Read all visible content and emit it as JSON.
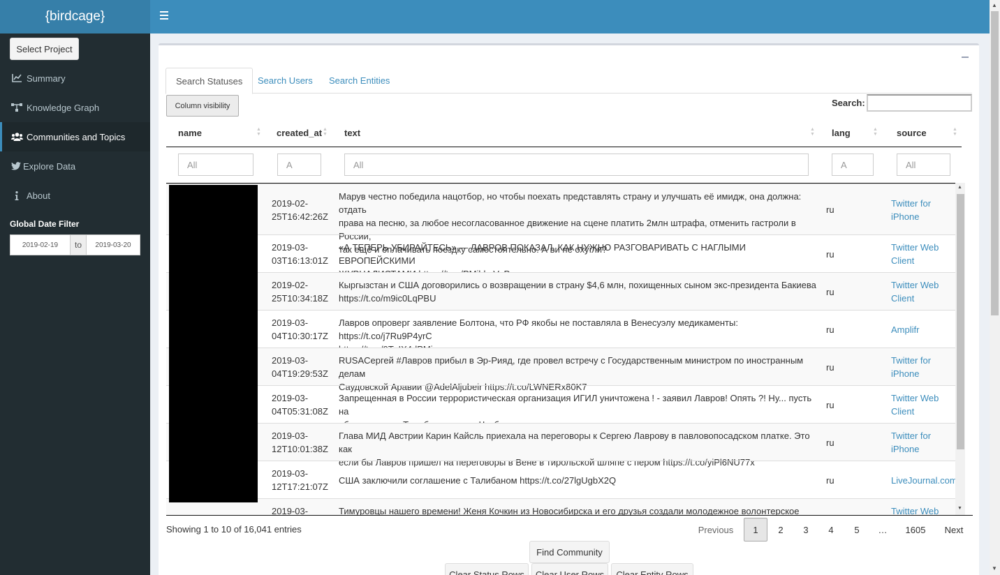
{
  "app": {
    "logo": "{birdcage}"
  },
  "sidebar": {
    "select_project": "Select Project",
    "items": [
      {
        "label": "Summary",
        "icon": "line-chart-icon"
      },
      {
        "label": "Knowledge Graph",
        "icon": "sitemap-icon"
      },
      {
        "label": "Communities and Topics",
        "icon": "users-icon",
        "active": true
      },
      {
        "label": "Explore Data",
        "icon": "twitter-icon"
      },
      {
        "label": "About",
        "icon": "info-icon"
      }
    ],
    "date_filter": {
      "title": "Global Date Filter",
      "from": "2019-02-19",
      "separator": "to",
      "to": "2019-03-20"
    }
  },
  "tabs": [
    {
      "label": "Search Statuses",
      "active": true
    },
    {
      "label": "Search Users"
    },
    {
      "label": "Search Entities"
    }
  ],
  "table_controls": {
    "column_visibility": "Column visibility",
    "search_label": "Search:",
    "search_value": ""
  },
  "columns": [
    "name",
    "created_at",
    "text",
    "lang",
    "source"
  ],
  "filters": {
    "name": "All",
    "created_at": "A",
    "text": "All",
    "lang": "A",
    "source": "All"
  },
  "rows": [
    {
      "created_at": [
        "2019-02-",
        "25T16:42:26Z"
      ],
      "text": [
        "Марув честно победила нацотбор, но чтобы поехать представлять страну и улучшать её имидж, она должна: отдать",
        "права на песню, за любое несогласованное движение на сцене платить 2млн штрафа, отменить гастроли в России,",
        "так ещё и оплачивать поездку самостоятельно. А ви не охуїли?"
      ],
      "lang": "ru",
      "source": [
        "Twitter for",
        "iPhone"
      ]
    },
    {
      "created_at": [
        "2019-03-",
        "03T16:13:01Z"
      ],
      "text": [
        "«А ТЕПЕРЬ УБИРАЙТЕСЬ» — ЛАВРОВ ПОКАЗАЛ, КАК НУЖНО РАЗГОВАРИВАТЬ С НАГЛЫМИ ЕВРОПЕЙСКИМИ",
        "ЖУРНАЛИСТАМИ https://t.co/PMjbhzVoPr"
      ],
      "lang": "ru",
      "source": [
        "Twitter Web",
        "Client"
      ]
    },
    {
      "created_at": [
        "2019-02-",
        "25T10:34:18Z"
      ],
      "text": [
        "Кыргызстан и США договорились о возвращении в страну $4,6 млн, похищенных сыном экс-президента Бакиева",
        "https://t.co/m9ic0LqPBU"
      ],
      "lang": "ru",
      "source": [
        "Twitter Web",
        "Client"
      ]
    },
    {
      "created_at": [
        "2019-03-",
        "04T10:30:17Z"
      ],
      "text": [
        "Лавров опроверг заявление Болтона, что РФ якобы не поставляла в Венесуэлу медикаменты: https://t.co/j7Ru9P4yrC",
        "https://t.co/9TuIX4dPMi"
      ],
      "lang": "ru",
      "source": [
        "Amplifr"
      ]
    },
    {
      "created_at": [
        "2019-03-",
        "04T19:29:53Z"
      ],
      "text": [
        "RUSAСергей #Лавров прибыл в Эр-Рияд, где провел встречу с Государственным министром по иностранным делам",
        "Саудовской Аравии @AdelAljubeir https://t.co/LWNERx80K7"
      ],
      "lang": "ru",
      "source": [
        "Twitter for",
        "iPhone"
      ]
    },
    {
      "created_at": [
        "2019-03-",
        "04T05:31:08Z"
      ],
      "text": [
        "Запрещенная в России террористическая организация ИГИЛ уничтожена ! - заявил Лавров! Опять ?! Ну... пусть на",
        "обратном пути Талибан возьмут. Чтоб два раза не ездить ."
      ],
      "lang": "ru",
      "source": [
        "Twitter Web",
        "Client"
      ]
    },
    {
      "created_at": [
        "2019-03-",
        "12T10:01:38Z"
      ],
      "text": [
        "Глава МИД Австрии Карин Кайсль приехала на переговоры к Сергею Лаврову в павловопосадском платке. Это как",
        "если бы Лавров пришел на переговоры в Вене в тирольской шляпе с пером https://t.co/yiPl6NU77x"
      ],
      "lang": "ru",
      "source": [
        "Twitter for",
        "iPhone"
      ]
    },
    {
      "created_at": [
        "2019-03-",
        "12T17:21:07Z"
      ],
      "text": [
        "США заключили соглашение с Талибаном https://t.co/27lgUgbX2Q"
      ],
      "lang": "ru",
      "source": [
        "LiveJournal.com"
      ]
    },
    {
      "created_at": [
        "2019-03-",
        ""
      ],
      "text": [
        "Тимуровцы нашего времени! Женя Кочкин из Новосибирска и его друзья создали молодежное волонтерское",
        ""
      ],
      "lang": "",
      "source": [
        "Twitter Web",
        ""
      ]
    }
  ],
  "footer": {
    "info": "Showing 1 to 10 of 16,041 entries",
    "pagination": {
      "previous": "Previous",
      "pages": [
        "1",
        "2",
        "3",
        "4",
        "5",
        "…",
        "1605"
      ],
      "next": "Next"
    }
  },
  "actions": {
    "find_community": "Find Community",
    "clear_status": "Clear Status Rows",
    "clear_user": "Clear User Rows",
    "clear_entity": "Clear Entity Rows"
  }
}
